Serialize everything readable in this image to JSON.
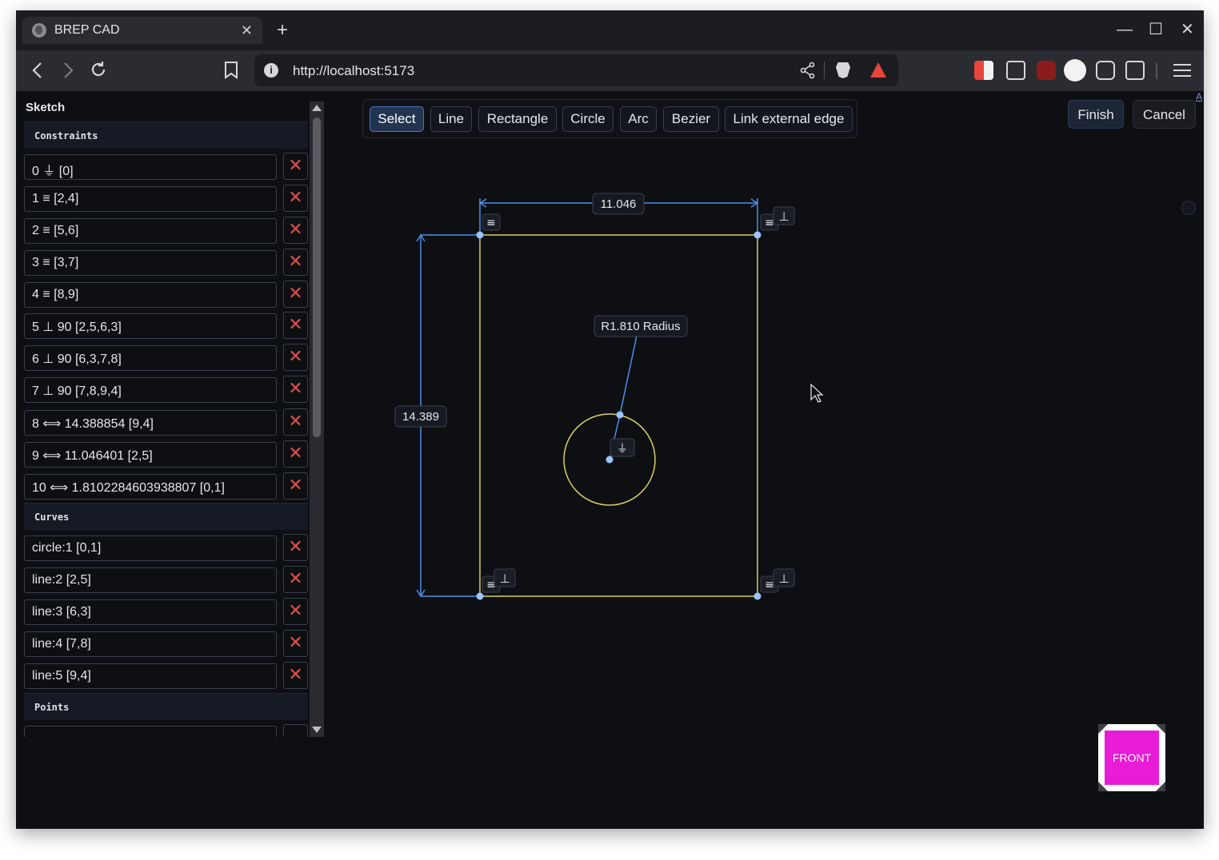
{
  "browser": {
    "tab_title": "BREP CAD",
    "tab_close": "✕",
    "new_tab": "+",
    "url": "http://localhost:5173",
    "window_controls": {
      "minimize": "—",
      "maximize": "☐",
      "close": "✕"
    },
    "icons": [
      "back-icon",
      "forward-icon",
      "reload-icon",
      "bookmark-icon",
      "share-icon",
      "brave-shield-icon",
      "brave-rewards-icon",
      "extensions-icon",
      "menu-icon"
    ]
  },
  "sidebar": {
    "title": "Sketch",
    "sections": {
      "constraints": "Constraints",
      "curves": "Curves",
      "points": "Points"
    },
    "constraints": [
      "0 ⏚ [0]",
      "1 ≡ [2,4]",
      "2 ≡ [5,6]",
      "3 ≡ [3,7]",
      "4 ≡ [8,9]",
      "5 ⊥ 90 [2,5,6,3]",
      "6 ⊥ 90 [6,3,7,8]",
      "7 ⊥ 90 [7,8,9,4]",
      "8 ⟺ 14.388854 [9,4]",
      "9 ⟺ 11.046401 [2,5]",
      "10 ⟺ 1.8102284603938807 [0,1]"
    ],
    "curves": [
      "circle:1 [0,1]",
      "line:2 [2,5]",
      "line:3 [6,3]",
      "line:4 [7,8]",
      "line:5 [9,4]"
    ],
    "delete_label": "✕"
  },
  "tools": [
    "Select",
    "Line",
    "Rectangle",
    "Circle",
    "Arc",
    "Bezier",
    "Link external edge"
  ],
  "active_tool": "Select",
  "actions": {
    "finish": "Finish",
    "cancel": "Cancel"
  },
  "corner_link": "A",
  "sketch": {
    "width_dim": "11.046",
    "height_dim": "14.389",
    "radius_label": "R1.810 Radius",
    "glyphs": {
      "coincident": "≡",
      "perpendicular": "⊥",
      "ground": "⏚"
    },
    "colors": {
      "geometry": "#d8d060",
      "dimension": "#4f8fe8",
      "point": "#9cc4ff"
    }
  },
  "view_cube": {
    "face": "FRONT",
    "color": "#e81bd6"
  }
}
